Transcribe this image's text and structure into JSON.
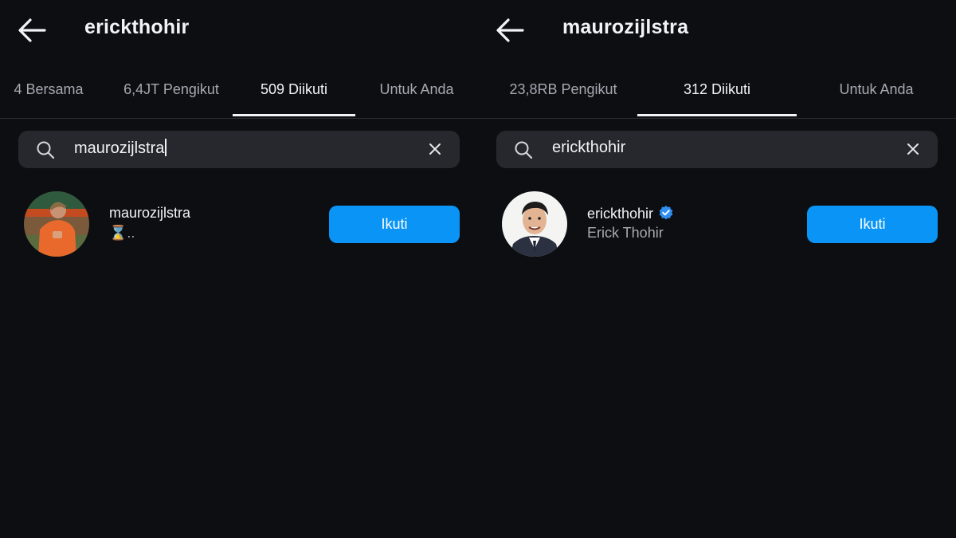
{
  "left": {
    "header": {
      "title": "erickthohir"
    },
    "tabs": [
      {
        "label": "4 Bersama"
      },
      {
        "label": "6,4JT Pengikut"
      },
      {
        "label": "509 Diikuti",
        "active": true
      },
      {
        "label": "Untuk Anda"
      }
    ],
    "search": {
      "value": "maurozijlstra"
    },
    "result": {
      "username": "maurozijlstra",
      "subtitle": "⌛..",
      "follow_label": "Ikuti"
    }
  },
  "right": {
    "header": {
      "title": "maurozijlstra"
    },
    "tabs": [
      {
        "label": "23,8RB Pengikut"
      },
      {
        "label": "312 Diikuti",
        "active": true
      },
      {
        "label": "Untuk Anda"
      }
    ],
    "search": {
      "value": "erickthohir"
    },
    "result": {
      "username": "erickthohir",
      "subtitle": "Erick Thohir",
      "verified": true,
      "follow_label": "Ikuti"
    }
  },
  "colors": {
    "background": "#0c0e12",
    "accent": "#0a95f6",
    "search_bg": "#26282d",
    "muted_text": "#a6a9b0"
  },
  "icons": [
    "back-arrow-icon",
    "search-icon",
    "close-icon",
    "verified-badge-icon"
  ]
}
